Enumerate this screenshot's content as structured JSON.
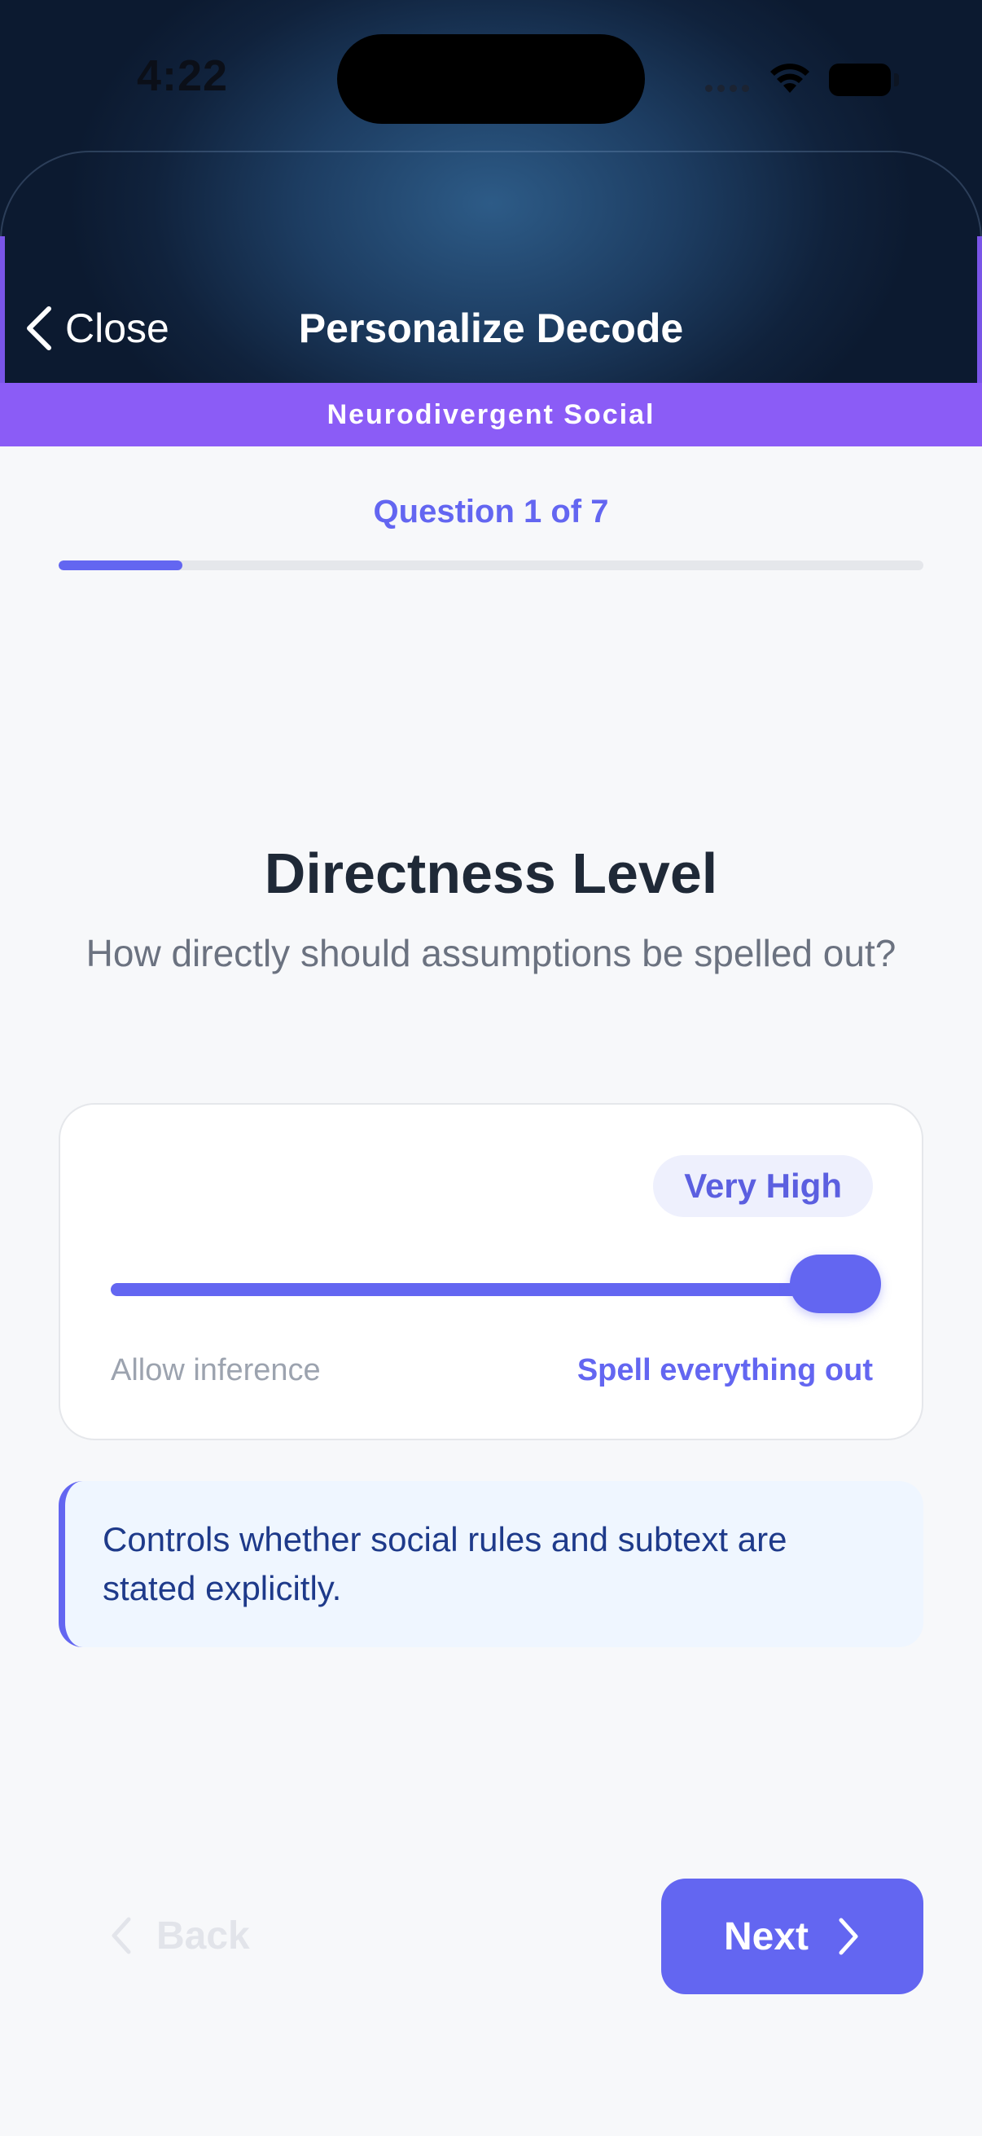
{
  "status_bar": {
    "time": "4:22"
  },
  "nav": {
    "back_label": "Close",
    "title": "Personalize Decode"
  },
  "category": {
    "label": "Neurodivergent Social"
  },
  "progress": {
    "label": "Question 1 of 7",
    "current": 1,
    "total": 7
  },
  "question": {
    "title": "Directness Level",
    "subtitle": "How directly should assumptions be spelled out?"
  },
  "slider": {
    "value_label": "Very High",
    "value_fraction": 1.0,
    "min_label": "Allow inference",
    "max_label": "Spell everything out"
  },
  "info": {
    "text": "Controls whether social rules and subtext are stated explicitly."
  },
  "footer": {
    "back_label": "Back",
    "next_label": "Next"
  },
  "colors": {
    "accent": "#6366f1",
    "category_bar": "#8b5cf6",
    "info_bg": "#eff6ff",
    "info_text": "#1e3a8a"
  }
}
